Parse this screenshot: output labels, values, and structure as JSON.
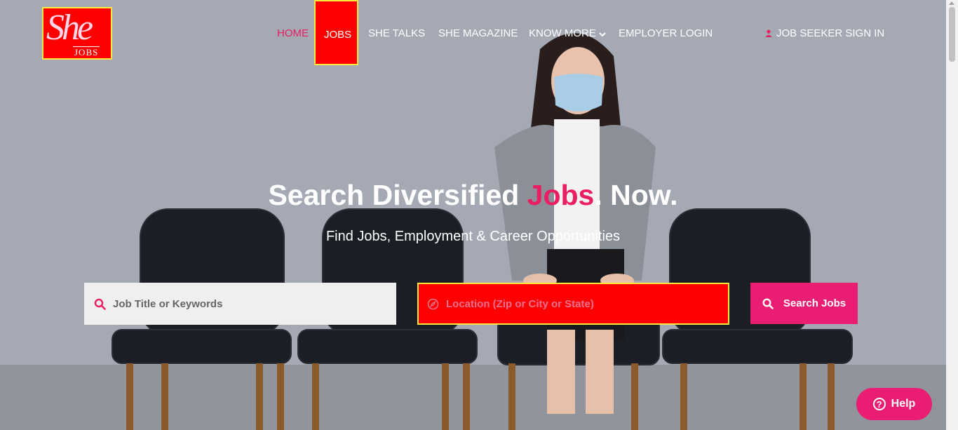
{
  "brand": {
    "logo_main": "She",
    "logo_sub": "JOBS"
  },
  "nav": {
    "home": "HOME",
    "jobs": "JOBS",
    "she_talks": "SHE TALKS",
    "she_magazine": "SHE MAGAZINE",
    "know_more": "KNOW MORE",
    "employer_login": "EMPLOYER LOGIN",
    "job_seeker_sign_in": "JOB SEEKER SIGN IN"
  },
  "hero": {
    "headline_part1": "Search Diversified ",
    "headline_accent": "Jobs",
    "headline_part2": ". Now.",
    "subheadline": "Find Jobs, Employment & Career Opportunities"
  },
  "search": {
    "keywords_placeholder": "Job Title or Keywords",
    "location_placeholder": "Location (Zip or City or State)",
    "button_label": "Search Jobs"
  },
  "help": {
    "label": "Help"
  },
  "colors": {
    "accent": "#e91e72",
    "highlight": "#ff0000",
    "outline": "#ffeb3b"
  },
  "icons": [
    "search-icon",
    "compass-icon",
    "user-icon",
    "chevron-down-icon",
    "question-icon"
  ]
}
